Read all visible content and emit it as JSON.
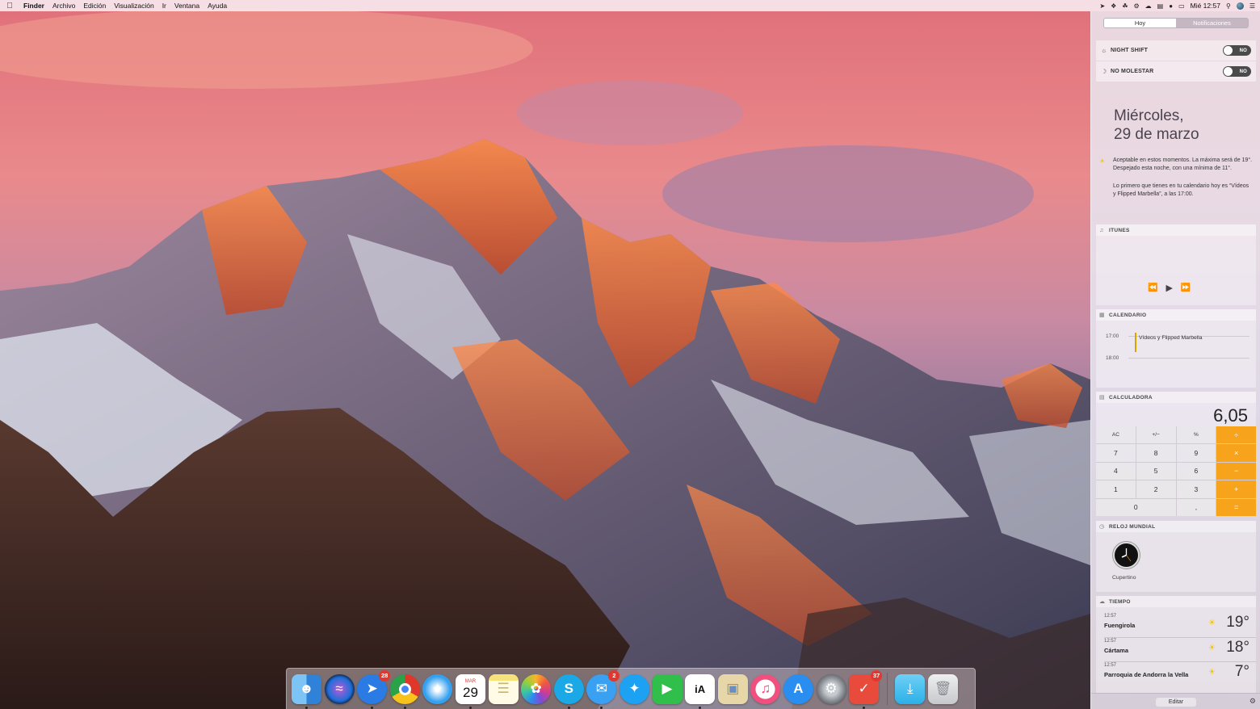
{
  "menubar": {
    "apple_icon": "apple-logo-icon",
    "items": [
      "Finder",
      "Archivo",
      "Edición",
      "Visualización",
      "Ir",
      "Ventana",
      "Ayuda"
    ],
    "clock": "Mié 12:57",
    "status_icons": [
      "location-icon",
      "dropbox-icon",
      "evernote-icon",
      "backup-icon",
      "cloud-icon",
      "clipboard-icon",
      "wifi-icon",
      "airplay-icon",
      "search-icon",
      "user-icon",
      "list-icon"
    ]
  },
  "notification_center": {
    "tabs": [
      "Hoy",
      "Notificaciones"
    ],
    "active_tab": "Hoy",
    "toggles": [
      {
        "label": "NIGHT SHIFT",
        "state": "NO",
        "icon": "sun-dim-icon"
      },
      {
        "label": "NO MOLESTAR",
        "state": "NO",
        "icon": "moon-icon"
      }
    ],
    "date_line1": "Miércoles,",
    "date_line2": "29 de marzo",
    "summary_weather": "Aceptable en estos momentos. La máxima será de 19°. Despejado esta noche, con una mínima de 11°.",
    "summary_calendar": "Lo primero que tienes en tu calendario hoy es “Vídeos y Flipped Marbella”, a las 17:00.",
    "itunes": {
      "title": "ITUNES"
    },
    "calendar": {
      "title": "CALENDARIO",
      "time_start": "17:00",
      "time_end": "18:00",
      "event": "Vídeos y Flipped Marbella"
    },
    "calculator": {
      "title": "CALCULADORA",
      "display": "6,05",
      "keys": [
        "AC",
        "+/−",
        "%",
        "÷",
        "7",
        "8",
        "9",
        "×",
        "4",
        "5",
        "6",
        "−",
        "1",
        "2",
        "3",
        "+",
        "0",
        ",",
        "="
      ]
    },
    "world_clock": {
      "title": "RELOJ MUNDIAL",
      "city": "Cupertino"
    },
    "weather": {
      "title": "TIEMPO",
      "rows": [
        {
          "time": "12:57",
          "city": "Fuengirola",
          "temp": "19°"
        },
        {
          "time": "12:57",
          "city": "Cártama",
          "temp": "18°"
        },
        {
          "time": "12:57",
          "city": "Parroquia de Andorra la Vella",
          "temp": "7°"
        }
      ]
    },
    "edit_label": "Editar"
  },
  "dock": {
    "apps": [
      {
        "name": "Finder",
        "color": "#3d8fe0"
      },
      {
        "name": "Siri",
        "color": "#1b2440"
      },
      {
        "name": "Spark",
        "color": "#2a7be4",
        "badge": "28"
      },
      {
        "name": "Chrome",
        "color": "#e8e8e8"
      },
      {
        "name": "Safari",
        "color": "#2c8ce6"
      },
      {
        "name": "Calendario",
        "color": "#ffffff",
        "month": "MAR",
        "day": "29"
      },
      {
        "name": "Notas",
        "color": "#f6e27a"
      },
      {
        "name": "Fotos",
        "color": "#ffffff"
      },
      {
        "name": "Skype",
        "color": "#1ba8e6"
      },
      {
        "name": "Mensajes",
        "color": "#3aa0f2",
        "badge": "2"
      },
      {
        "name": "Twitter",
        "color": "#1da1f2"
      },
      {
        "name": "FaceTime",
        "color": "#2fbf4a"
      },
      {
        "name": "iA Writer",
        "color": "#ffffff"
      },
      {
        "name": "Vista previa",
        "color": "#e6d6a8"
      },
      {
        "name": "iTunes",
        "color": "#f14f7e"
      },
      {
        "name": "App Store",
        "color": "#2a8ef0"
      },
      {
        "name": "Preferencias del Sistema",
        "color": "#7a7f86"
      },
      {
        "name": "Wunderlist",
        "color": "#e84a3c",
        "badge": "37"
      },
      {
        "name": "Descargas",
        "color": "#2bb0e8"
      },
      {
        "name": "Papelera",
        "color": "#d9dadc"
      }
    ]
  }
}
